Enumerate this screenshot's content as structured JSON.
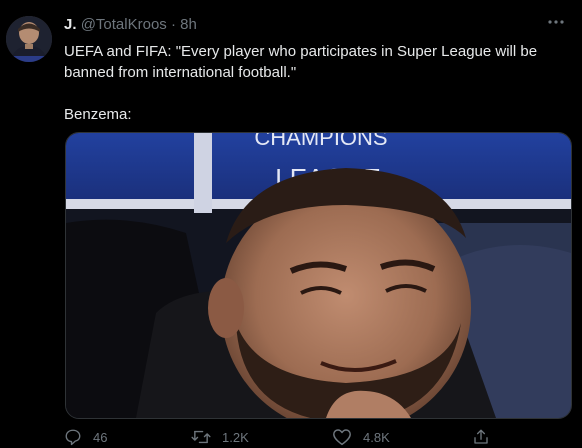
{
  "tweet": {
    "name": "J.",
    "handle": "@TotalKroos",
    "separator": "·",
    "time": "8h",
    "text_line1": "UEFA and FIFA: \"Every player who participates in Super League will be",
    "text_line2": "banned from international football.\"",
    "text_line3": "Benzema:"
  },
  "media": {
    "banner_text_top": "CHAMPIONS",
    "banner_text_bottom": "LEAGUE"
  },
  "actions": {
    "replies": "46",
    "retweets": "1.2K",
    "likes": "4.8K"
  },
  "icons": {
    "reply": "reply-icon",
    "retweet": "retweet-icon",
    "like": "heart-icon",
    "share": "share-icon",
    "more": "more-icon"
  },
  "colors": {
    "background": "#000000",
    "text": "#e7e9ea",
    "muted": "#6e767d",
    "banner_blue": "#1c3a9e"
  }
}
